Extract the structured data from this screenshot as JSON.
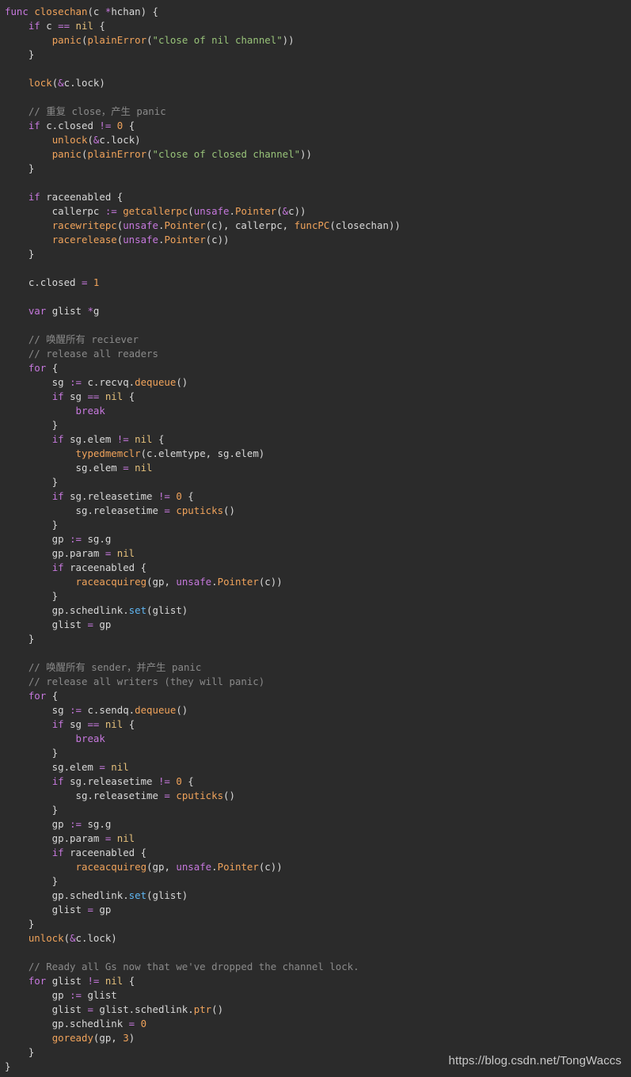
{
  "code": {
    "lines": [
      [
        {
          "t": "func",
          "k": "keyword"
        },
        {
          "t": " "
        },
        {
          "t": "closechan",
          "k": "function"
        },
        {
          "t": "(c "
        },
        {
          "t": "*",
          "k": "operator"
        },
        {
          "t": "hchan) {"
        }
      ],
      [
        {
          "t": "    "
        },
        {
          "t": "if",
          "k": "keyword"
        },
        {
          "t": " c "
        },
        {
          "t": "==",
          "k": "operator"
        },
        {
          "t": " "
        },
        {
          "t": "nil",
          "k": "nil"
        },
        {
          "t": " {"
        }
      ],
      [
        {
          "t": "        "
        },
        {
          "t": "panic",
          "k": "function"
        },
        {
          "t": "("
        },
        {
          "t": "plainError",
          "k": "function"
        },
        {
          "t": "("
        },
        {
          "t": "\"close of nil channel\"",
          "k": "string"
        },
        {
          "t": "))"
        }
      ],
      [
        {
          "t": "    }"
        }
      ],
      [],
      [
        {
          "t": "    "
        },
        {
          "t": "lock",
          "k": "function"
        },
        {
          "t": "("
        },
        {
          "t": "&",
          "k": "operator"
        },
        {
          "t": "c.lock)"
        }
      ],
      [],
      [
        {
          "t": "    // 重复 close，产生 panic",
          "k": "comment"
        }
      ],
      [
        {
          "t": "    "
        },
        {
          "t": "if",
          "k": "keyword"
        },
        {
          "t": " c.closed "
        },
        {
          "t": "!=",
          "k": "operator"
        },
        {
          "t": " "
        },
        {
          "t": "0",
          "k": "number"
        },
        {
          "t": " {"
        }
      ],
      [
        {
          "t": "        "
        },
        {
          "t": "unlock",
          "k": "function"
        },
        {
          "t": "("
        },
        {
          "t": "&",
          "k": "operator"
        },
        {
          "t": "c.lock)"
        }
      ],
      [
        {
          "t": "        "
        },
        {
          "t": "panic",
          "k": "function"
        },
        {
          "t": "("
        },
        {
          "t": "plainError",
          "k": "function"
        },
        {
          "t": "("
        },
        {
          "t": "\"close of closed channel\"",
          "k": "string"
        },
        {
          "t": "))"
        }
      ],
      [
        {
          "t": "    }"
        }
      ],
      [],
      [
        {
          "t": "    "
        },
        {
          "t": "if",
          "k": "keyword"
        },
        {
          "t": " raceenabled {"
        }
      ],
      [
        {
          "t": "        callerpc "
        },
        {
          "t": ":=",
          "k": "operator"
        },
        {
          "t": " "
        },
        {
          "t": "getcallerpc",
          "k": "function"
        },
        {
          "t": "("
        },
        {
          "t": "unsafe",
          "k": "keyword"
        },
        {
          "t": "."
        },
        {
          "t": "Pointer",
          "k": "function"
        },
        {
          "t": "("
        },
        {
          "t": "&",
          "k": "operator"
        },
        {
          "t": "c))"
        }
      ],
      [
        {
          "t": "        "
        },
        {
          "t": "racewritepc",
          "k": "function"
        },
        {
          "t": "("
        },
        {
          "t": "unsafe",
          "k": "keyword"
        },
        {
          "t": "."
        },
        {
          "t": "Pointer",
          "k": "function"
        },
        {
          "t": "(c), callerpc, "
        },
        {
          "t": "funcPC",
          "k": "function"
        },
        {
          "t": "(closechan))"
        }
      ],
      [
        {
          "t": "        "
        },
        {
          "t": "racerelease",
          "k": "function"
        },
        {
          "t": "("
        },
        {
          "t": "unsafe",
          "k": "keyword"
        },
        {
          "t": "."
        },
        {
          "t": "Pointer",
          "k": "function"
        },
        {
          "t": "(c))"
        }
      ],
      [
        {
          "t": "    }"
        }
      ],
      [],
      [
        {
          "t": "    c.closed "
        },
        {
          "t": "=",
          "k": "operator"
        },
        {
          "t": " "
        },
        {
          "t": "1",
          "k": "number"
        }
      ],
      [],
      [
        {
          "t": "    "
        },
        {
          "t": "var",
          "k": "keyword"
        },
        {
          "t": " glist "
        },
        {
          "t": "*",
          "k": "operator"
        },
        {
          "t": "g"
        }
      ],
      [],
      [
        {
          "t": "    // 唤醒所有 reciever",
          "k": "comment"
        }
      ],
      [
        {
          "t": "    // release all readers",
          "k": "comment"
        }
      ],
      [
        {
          "t": "    "
        },
        {
          "t": "for",
          "k": "keyword"
        },
        {
          "t": " {"
        }
      ],
      [
        {
          "t": "        sg "
        },
        {
          "t": ":=",
          "k": "operator"
        },
        {
          "t": " c.recvq."
        },
        {
          "t": "dequeue",
          "k": "function"
        },
        {
          "t": "()"
        }
      ],
      [
        {
          "t": "        "
        },
        {
          "t": "if",
          "k": "keyword"
        },
        {
          "t": " sg "
        },
        {
          "t": "==",
          "k": "operator"
        },
        {
          "t": " "
        },
        {
          "t": "nil",
          "k": "nil"
        },
        {
          "t": " {"
        }
      ],
      [
        {
          "t": "            "
        },
        {
          "t": "break",
          "k": "keyword"
        }
      ],
      [
        {
          "t": "        }"
        }
      ],
      [
        {
          "t": "        "
        },
        {
          "t": "if",
          "k": "keyword"
        },
        {
          "t": " sg.elem "
        },
        {
          "t": "!=",
          "k": "operator"
        },
        {
          "t": " "
        },
        {
          "t": "nil",
          "k": "nil"
        },
        {
          "t": " {"
        }
      ],
      [
        {
          "t": "            "
        },
        {
          "t": "typedmemclr",
          "k": "function"
        },
        {
          "t": "(c.elemtype, sg.elem)"
        }
      ],
      [
        {
          "t": "            sg.elem "
        },
        {
          "t": "=",
          "k": "operator"
        },
        {
          "t": " "
        },
        {
          "t": "nil",
          "k": "nil"
        }
      ],
      [
        {
          "t": "        }"
        }
      ],
      [
        {
          "t": "        "
        },
        {
          "t": "if",
          "k": "keyword"
        },
        {
          "t": " sg.releasetime "
        },
        {
          "t": "!=",
          "k": "operator"
        },
        {
          "t": " "
        },
        {
          "t": "0",
          "k": "number"
        },
        {
          "t": " {"
        }
      ],
      [
        {
          "t": "            sg.releasetime "
        },
        {
          "t": "=",
          "k": "operator"
        },
        {
          "t": " "
        },
        {
          "t": "cputicks",
          "k": "function"
        },
        {
          "t": "()"
        }
      ],
      [
        {
          "t": "        }"
        }
      ],
      [
        {
          "t": "        gp "
        },
        {
          "t": ":=",
          "k": "operator"
        },
        {
          "t": " sg.g"
        }
      ],
      [
        {
          "t": "        gp.param "
        },
        {
          "t": "=",
          "k": "operator"
        },
        {
          "t": " "
        },
        {
          "t": "nil",
          "k": "nil"
        }
      ],
      [
        {
          "t": "        "
        },
        {
          "t": "if",
          "k": "keyword"
        },
        {
          "t": " raceenabled {"
        }
      ],
      [
        {
          "t": "            "
        },
        {
          "t": "raceacquireg",
          "k": "function"
        },
        {
          "t": "(gp, "
        },
        {
          "t": "unsafe",
          "k": "keyword"
        },
        {
          "t": "."
        },
        {
          "t": "Pointer",
          "k": "function"
        },
        {
          "t": "(c))"
        }
      ],
      [
        {
          "t": "        }"
        }
      ],
      [
        {
          "t": "        gp.schedlink."
        },
        {
          "t": "set",
          "k": "type"
        },
        {
          "t": "(glist)"
        }
      ],
      [
        {
          "t": "        glist "
        },
        {
          "t": "=",
          "k": "operator"
        },
        {
          "t": " gp"
        }
      ],
      [
        {
          "t": "    }"
        }
      ],
      [],
      [
        {
          "t": "    // 唤醒所有 sender，并产生 panic",
          "k": "comment"
        }
      ],
      [
        {
          "t": "    // release all writers (they will panic)",
          "k": "comment"
        }
      ],
      [
        {
          "t": "    "
        },
        {
          "t": "for",
          "k": "keyword"
        },
        {
          "t": " {"
        }
      ],
      [
        {
          "t": "        sg "
        },
        {
          "t": ":=",
          "k": "operator"
        },
        {
          "t": " c.sendq."
        },
        {
          "t": "dequeue",
          "k": "function"
        },
        {
          "t": "()"
        }
      ],
      [
        {
          "t": "        "
        },
        {
          "t": "if",
          "k": "keyword"
        },
        {
          "t": " sg "
        },
        {
          "t": "==",
          "k": "operator"
        },
        {
          "t": " "
        },
        {
          "t": "nil",
          "k": "nil"
        },
        {
          "t": " {"
        }
      ],
      [
        {
          "t": "            "
        },
        {
          "t": "break",
          "k": "keyword"
        }
      ],
      [
        {
          "t": "        }"
        }
      ],
      [
        {
          "t": "        sg.elem "
        },
        {
          "t": "=",
          "k": "operator"
        },
        {
          "t": " "
        },
        {
          "t": "nil",
          "k": "nil"
        }
      ],
      [
        {
          "t": "        "
        },
        {
          "t": "if",
          "k": "keyword"
        },
        {
          "t": " sg.releasetime "
        },
        {
          "t": "!=",
          "k": "operator"
        },
        {
          "t": " "
        },
        {
          "t": "0",
          "k": "number"
        },
        {
          "t": " {"
        }
      ],
      [
        {
          "t": "            sg.releasetime "
        },
        {
          "t": "=",
          "k": "operator"
        },
        {
          "t": " "
        },
        {
          "t": "cputicks",
          "k": "function"
        },
        {
          "t": "()"
        }
      ],
      [
        {
          "t": "        }"
        }
      ],
      [
        {
          "t": "        gp "
        },
        {
          "t": ":=",
          "k": "operator"
        },
        {
          "t": " sg.g"
        }
      ],
      [
        {
          "t": "        gp.param "
        },
        {
          "t": "=",
          "k": "operator"
        },
        {
          "t": " "
        },
        {
          "t": "nil",
          "k": "nil"
        }
      ],
      [
        {
          "t": "        "
        },
        {
          "t": "if",
          "k": "keyword"
        },
        {
          "t": " raceenabled {"
        }
      ],
      [
        {
          "t": "            "
        },
        {
          "t": "raceacquireg",
          "k": "function"
        },
        {
          "t": "(gp, "
        },
        {
          "t": "unsafe",
          "k": "keyword"
        },
        {
          "t": "."
        },
        {
          "t": "Pointer",
          "k": "function"
        },
        {
          "t": "(c))"
        }
      ],
      [
        {
          "t": "        }"
        }
      ],
      [
        {
          "t": "        gp.schedlink."
        },
        {
          "t": "set",
          "k": "type"
        },
        {
          "t": "(glist)"
        }
      ],
      [
        {
          "t": "        glist "
        },
        {
          "t": "=",
          "k": "operator"
        },
        {
          "t": " gp"
        }
      ],
      [
        {
          "t": "    }"
        }
      ],
      [
        {
          "t": "    "
        },
        {
          "t": "unlock",
          "k": "function"
        },
        {
          "t": "("
        },
        {
          "t": "&",
          "k": "operator"
        },
        {
          "t": "c.lock)"
        }
      ],
      [],
      [
        {
          "t": "    // Ready all Gs now that we've dropped the channel lock.",
          "k": "comment"
        }
      ],
      [
        {
          "t": "    "
        },
        {
          "t": "for",
          "k": "keyword"
        },
        {
          "t": " glist "
        },
        {
          "t": "!=",
          "k": "operator"
        },
        {
          "t": " "
        },
        {
          "t": "nil",
          "k": "nil"
        },
        {
          "t": " {"
        }
      ],
      [
        {
          "t": "        gp "
        },
        {
          "t": ":=",
          "k": "operator"
        },
        {
          "t": " glist"
        }
      ],
      [
        {
          "t": "        glist "
        },
        {
          "t": "=",
          "k": "operator"
        },
        {
          "t": " glist.schedlink."
        },
        {
          "t": "ptr",
          "k": "function"
        },
        {
          "t": "()"
        }
      ],
      [
        {
          "t": "        gp.schedlink "
        },
        {
          "t": "=",
          "k": "operator"
        },
        {
          "t": " "
        },
        {
          "t": "0",
          "k": "number"
        }
      ],
      [
        {
          "t": "        "
        },
        {
          "t": "goready",
          "k": "function"
        },
        {
          "t": "(gp, "
        },
        {
          "t": "3",
          "k": "number"
        },
        {
          "t": ")"
        }
      ],
      [
        {
          "t": "    }"
        }
      ],
      [
        {
          "t": "}"
        }
      ]
    ]
  },
  "watermark": "https://blog.csdn.net/TongWaccs",
  "colors": {
    "background": "#2b2b2b",
    "plain": "#d8d8d8",
    "keyword": "#c678dd",
    "function": "#f0a35b",
    "type": "#5fb6f2",
    "string": "#98c379",
    "comment": "#8a8a8a",
    "number": "#f0a35b",
    "nil": "#e5c07b"
  }
}
